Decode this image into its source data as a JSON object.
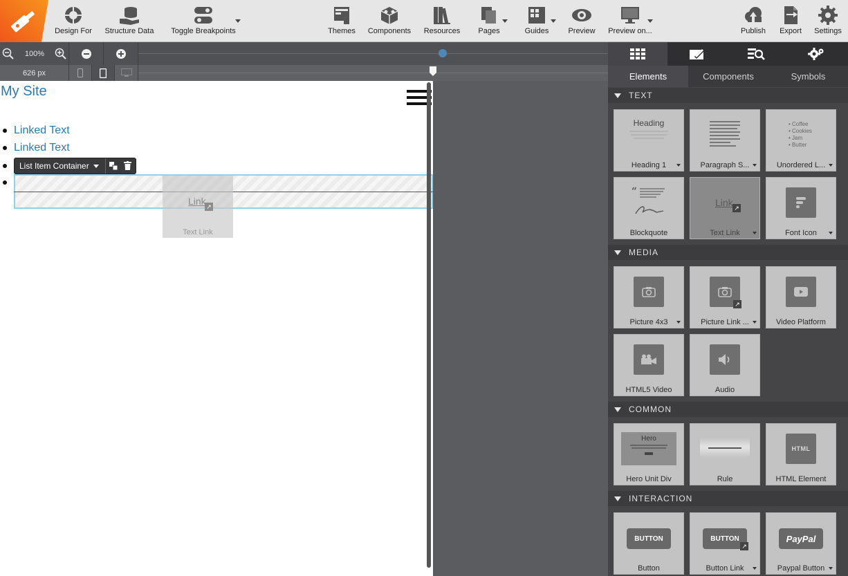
{
  "toolbar": {
    "design_for": "Design For",
    "structure_data": "Structure Data",
    "toggle_breakpoints": "Toggle Breakpoints",
    "themes": "Themes",
    "components": "Components",
    "resources": "Resources",
    "pages": "Pages",
    "guides": "Guides",
    "preview": "Preview",
    "preview_on": "Preview on...",
    "publish": "Publish",
    "export": "Export",
    "settings": "Settings"
  },
  "zoom": {
    "level": "100%",
    "width": "626 px"
  },
  "canvas": {
    "site_title": "My Site",
    "list_items": [
      "Linked Text",
      "Linked Text"
    ],
    "container_label": "List Item Container",
    "ghost_link": "Link",
    "ghost_label": "Text Link"
  },
  "panel": {
    "tabs": [
      "Elements",
      "Components",
      "Symbols"
    ],
    "sections": {
      "text": "TEXT",
      "media": "MEDIA",
      "common": "COMMON",
      "interaction": "INTERACTION"
    },
    "text_items": [
      "Heading 1",
      "Paragraph S...",
      "Unordered L...",
      "Blockquote",
      "Text Link",
      "Font Icon"
    ],
    "media_items": [
      "Picture 4x3",
      "Picture Link ...",
      "Video Platform",
      "HTML5 Video",
      "Audio"
    ],
    "common_items": [
      "Hero Unit Div",
      "Rule",
      "HTML Element"
    ],
    "interaction_items": [
      "Button",
      "Button Link",
      "Paypal Button"
    ],
    "preview_text": {
      "heading": "Heading",
      "list": [
        "Coffee",
        "Cookies",
        "Jam",
        "Butter"
      ],
      "link": "Link",
      "hero": "Hero",
      "html": "HTML",
      "button": "BUTTON",
      "paypal": "PayPal"
    }
  },
  "colors": {
    "accent_orange": "#f26a1b",
    "link_blue": "#2a7ab0",
    "drop_outline": "#8fd3ea"
  }
}
